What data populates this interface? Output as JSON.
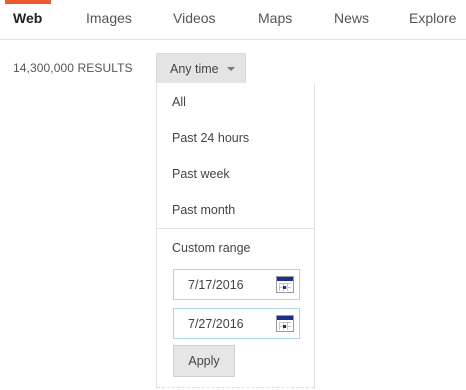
{
  "nav": {
    "tabs": [
      {
        "label": "Web",
        "active": true
      },
      {
        "label": "Images",
        "active": false
      },
      {
        "label": "Videos",
        "active": false
      },
      {
        "label": "Maps",
        "active": false
      },
      {
        "label": "News",
        "active": false
      },
      {
        "label": "Explore",
        "active": false
      }
    ],
    "accent_color": "#ec5a2f"
  },
  "results": {
    "count_text": "14,300,000 RESULTS"
  },
  "time_filter": {
    "selected_label": "Any time",
    "options": [
      "All",
      "Past 24 hours",
      "Past week",
      "Past month"
    ],
    "custom_range": {
      "label": "Custom range",
      "from_value": "7/17/2016",
      "to_value": "7/27/2016",
      "apply_label": "Apply"
    }
  },
  "icons": {
    "dropdown": "chevron-down-icon",
    "calendar": "calendar-icon"
  }
}
